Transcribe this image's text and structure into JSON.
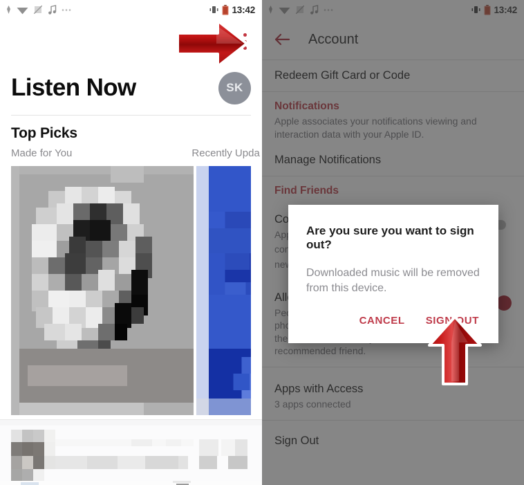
{
  "left_screen": {
    "status_bar": {
      "time": "13:42",
      "icons": [
        "location-icon",
        "wifi-icon",
        "sim-off-icon",
        "music-note-icon",
        "more-icon"
      ],
      "right_icons": [
        "vibrate-icon",
        "battery-low-icon"
      ]
    },
    "overflow_menu": "overflow-menu-icon",
    "page_title": "Listen Now",
    "avatar_initials": "SK",
    "section_title": "Top Picks",
    "subrow": {
      "left": "Made for You",
      "right": "Recently Upda"
    },
    "artwork": [
      {
        "name": "album-art-made-for-you",
        "label": ""
      },
      {
        "name": "album-art-recently-updated",
        "label": ""
      }
    ],
    "mini_player": "mini-player-bar"
  },
  "right_screen": {
    "status_bar": {
      "time": "13:42",
      "icons": [
        "location-icon",
        "wifi-icon",
        "sim-off-icon",
        "music-note-icon",
        "more-icon"
      ],
      "right_icons": [
        "vibrate-icon",
        "battery-low-icon"
      ]
    },
    "app_bar": {
      "back": "back-arrow-icon",
      "title": "Account"
    },
    "rows": [
      {
        "title": "Redeem Gift Card or Code"
      }
    ],
    "notifications": {
      "heading": "Notifications",
      "description": "Apple associates your notifications viewing and interaction data with your Apple ID.",
      "action": "Manage Notifications"
    },
    "find_friends": {
      "heading": "Find Friends",
      "contacts": {
        "title": "Co",
        "desc_line1": "App",
        "desc_line2": "con",
        "desc_line3": "new",
        "toggle_on": false
      },
      "allow_finding": {
        "title": "Allow Finding by Apple ID",
        "description": "People who have the email address or phone number you use for your Apple ID in their contacts will see you as a recommended friend.",
        "toggle_on": true
      }
    },
    "apps_with_access": {
      "title": "Apps with Access",
      "subtitle": "3 apps connected"
    },
    "sign_out_row": "Sign Out",
    "dialog": {
      "title": "Are you sure you want to sign out?",
      "message": "Downloaded music will be removed from this device.",
      "cancel": "CANCEL",
      "confirm": "SIGN OUT"
    }
  },
  "annotations": [
    {
      "name": "arrow-to-overflow-menu",
      "direction": "right",
      "color": "#c01a1a"
    },
    {
      "name": "arrow-to-sign-out-button",
      "direction": "up",
      "color": "#c01a1a"
    }
  ],
  "colors": {
    "accent_red": "#b5303c",
    "dialog_button": "#bf3b4a",
    "toggle_on": "#9d0f1f",
    "avatar_bg": "#8c9099",
    "arrow_red": "#c01a1a"
  }
}
